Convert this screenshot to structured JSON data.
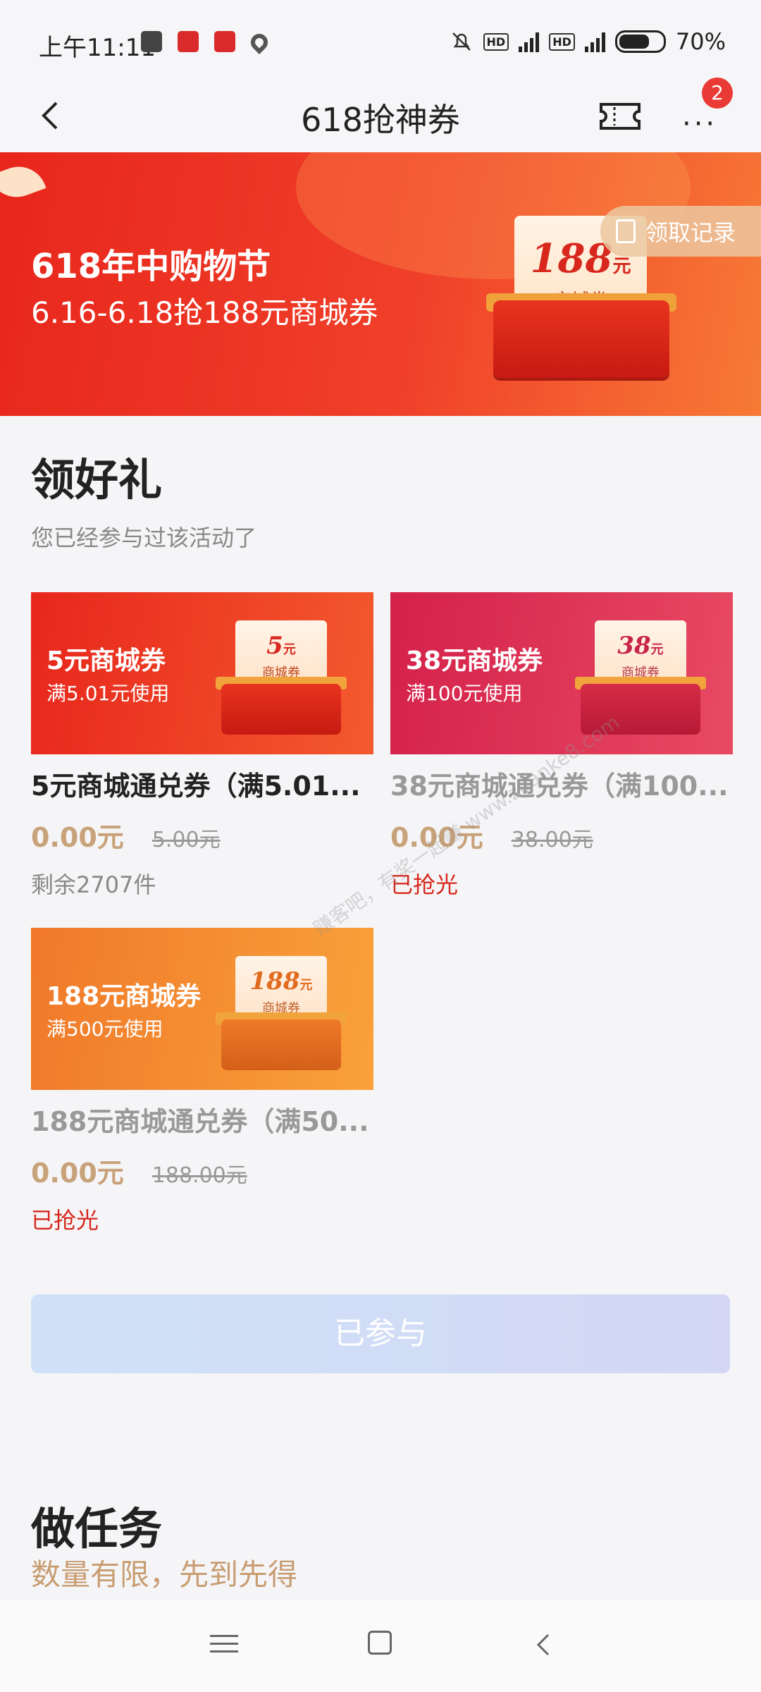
{
  "status_bar": {
    "time": "上午11:11",
    "hd_label": "HD",
    "network": "4G",
    "battery": "70%",
    "battery_level": 0.7
  },
  "nav": {
    "title": "618抢神券",
    "badge_count": "2",
    "icons": [
      "back-icon",
      "ticket-icon",
      "more-icon"
    ]
  },
  "banner": {
    "title": "618年中购物节",
    "subtitle": "6.16-6.18抢188元商城券",
    "gift_amount": "188",
    "gift_unit": "元",
    "gift_label": "商城券",
    "records_button": "领取记录"
  },
  "section": {
    "title": "领好礼",
    "subtitle": "您已经参与过该活动了"
  },
  "coupons": [
    {
      "banner_title": "5元商城券",
      "banner_condition": "满5.01元使用",
      "gift_amount": "5",
      "gift_unit": "元",
      "gift_label": "商城券",
      "name": "5元商城通兑券（满5.01...",
      "price": "0.00元",
      "original_price": "5.00元",
      "stock": "剩余2707件",
      "color": "#e8261c"
    },
    {
      "banner_title": "38元商城券",
      "banner_condition": "满100元使用",
      "gift_amount": "38",
      "gift_unit": "元",
      "gift_label": "商城券",
      "name": "38元商城通兑券（满100...",
      "price": "0.00元",
      "original_price": "38.00元",
      "stock": "已抢光",
      "color": "#d4214a"
    },
    {
      "banner_title": "188元商城券",
      "banner_condition": "满500元使用",
      "gift_amount": "188",
      "gift_unit": "元",
      "gift_label": "商城券",
      "name": "188元商城通兑券（满50...",
      "price": "0.00元",
      "original_price": "188.00元",
      "stock": "已抢光",
      "color": "#f0792a"
    }
  ],
  "joined_button": "已参与",
  "tasks": {
    "title": "做任务",
    "subtitle": "数量有限，先到先得"
  },
  "watermark": "赚客吧，有奖一起赚 www.zuanke8.com",
  "colors": {
    "accent_red": "#e8261c",
    "price_gold": "#c8a27a",
    "sold_out_red": "#d8281e",
    "badge_red": "#ea3a35"
  }
}
